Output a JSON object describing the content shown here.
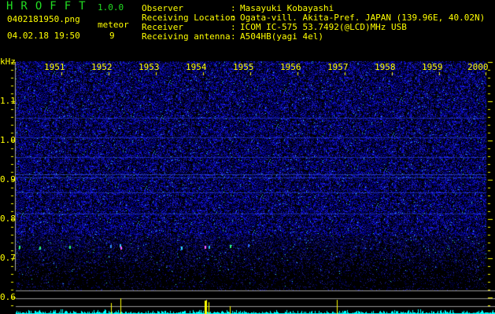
{
  "header": {
    "app_title": "HROFFT",
    "version": "1.0.0",
    "filename": "0402181950.png",
    "datetime": "04.02.18 19:50",
    "count_label": "meteor",
    "count_value": "9"
  },
  "info": [
    {
      "label": "Observer",
      "value": "Masayuki Kobayashi"
    },
    {
      "label": "Receiving Location",
      "value": "Ogata-vill. Akita-Pref. JAPAN (139.96E, 40.02N)"
    },
    {
      "label": "Receiver",
      "value": "ICOM IC-575 53.7492(@LCD)MHz USB"
    },
    {
      "label": "Receiving antenna",
      "value": "A504HB(yagi 4el)"
    }
  ],
  "spectrogram": {
    "y_unit": "kHz",
    "y_ticks": [
      "1.1",
      "1.0",
      "0.9",
      "0.8",
      "0.7",
      "0.6"
    ],
    "x_ticks": [
      "1951",
      "1952",
      "1953",
      "1954",
      "1955",
      "1956",
      "1957",
      "1958",
      "1959",
      "2000"
    ],
    "colors": {
      "background": "#000000",
      "noise": "#2020ff",
      "labels": "#ffff00",
      "histogram": "#00ffff",
      "spike": "#ffff00"
    }
  }
}
